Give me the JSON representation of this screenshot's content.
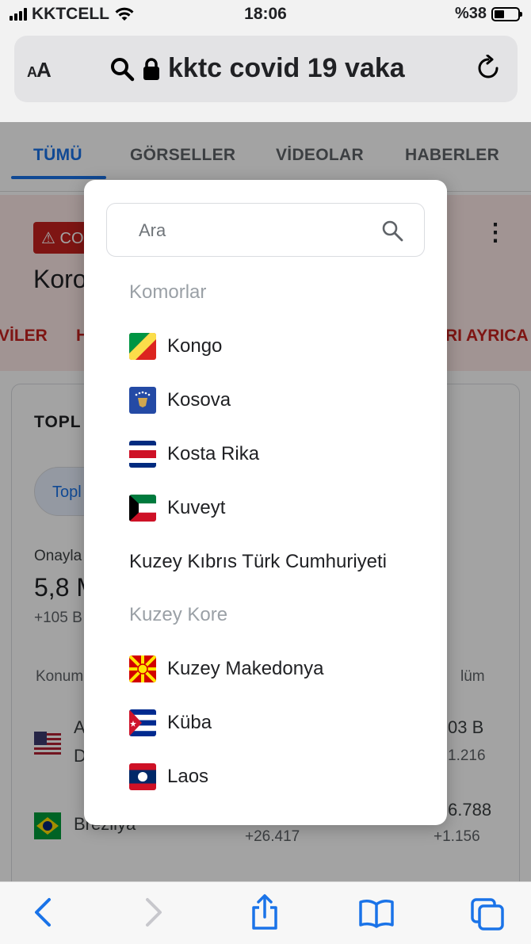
{
  "status_bar": {
    "carrier": "KKTCELL",
    "time": "18:06",
    "battery": "%38"
  },
  "browser": {
    "text_size_label_small": "A",
    "text_size_label_large": "A",
    "url": "kktc covid 19 vaka"
  },
  "page": {
    "tabs": [
      "TÜMÜ",
      "GÖRSELLER",
      "VİDEOLAR",
      "HABERLER"
    ],
    "alert": {
      "chip_text": "CO",
      "title": "Koro",
      "row_left": "VİLER",
      "row_mid": "H",
      "row_right": "RI AYRICA"
    },
    "card": {
      "heading": "TOPL",
      "pill": "Topl",
      "confirmed_label": "Onayla",
      "confirmed_value": "5,8 M",
      "confirmed_delta": "+105 B",
      "col_location": "Konum",
      "col_death": "lüm",
      "row1": {
        "name_a": "A",
        "name_d": "D",
        "death": "03 B",
        "death_delta": "1.216"
      },
      "row2": {
        "name": "Brezilya",
        "cases_delta": "+26.417",
        "death": "6.788",
        "death_delta": "+1.156"
      }
    }
  },
  "modal": {
    "search_placeholder": "Ara",
    "countries": [
      {
        "name": "Komorlar",
        "flag": "none",
        "enabled": false
      },
      {
        "name": "Kongo",
        "flag": "congo-flag",
        "enabled": true
      },
      {
        "name": "Kosova",
        "flag": "kosovo-flag",
        "enabled": true
      },
      {
        "name": "Kosta Rika",
        "flag": "costa-rica-flag",
        "enabled": true
      },
      {
        "name": "Kuveyt",
        "flag": "kuwait-flag",
        "enabled": true
      },
      {
        "name": "Kuzey Kıbrıs Türk Cumhuriyeti",
        "flag": "none",
        "enabled": true
      },
      {
        "name": "Kuzey Kore",
        "flag": "none",
        "enabled": false
      },
      {
        "name": "Kuzey Makedonya",
        "flag": "north-macedonia-flag",
        "enabled": true
      },
      {
        "name": "Küba",
        "flag": "cuba-flag",
        "enabled": true
      },
      {
        "name": "Laos",
        "flag": "laos-flag",
        "enabled": true
      }
    ]
  },
  "colors": {
    "accent": "#1a73e8",
    "alert_bg": "#fce8e6",
    "alert_red": "#c5221f",
    "disabled_text": "#9aa0a6"
  }
}
